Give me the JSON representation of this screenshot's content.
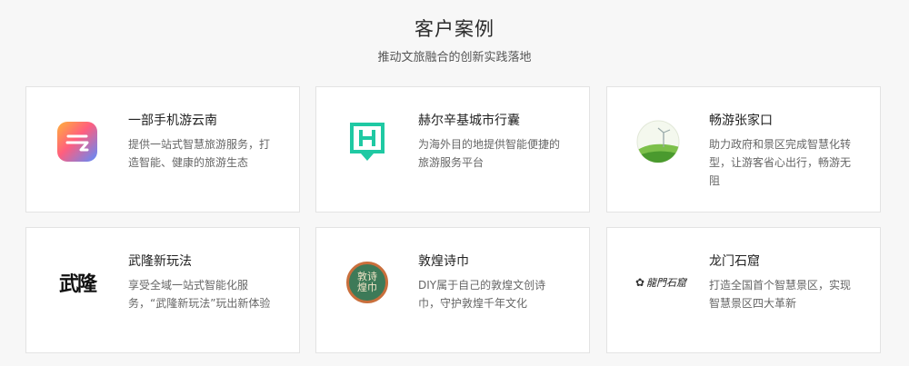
{
  "section": {
    "title": "客户案例",
    "subtitle": "推动文旅融合的创新实践落地"
  },
  "cards": [
    {
      "name": "一部手机游云南",
      "desc": "提供一站式智慧旅游服务，打造智能、健康的旅游生态",
      "logo_icon": "yunnan-app-icon"
    },
    {
      "name": "赫尔辛基城市行囊",
      "desc": "为海外目的地提供智能便捷的旅游服务平台",
      "logo_icon": "helsinki-h-icon"
    },
    {
      "name": "畅游张家口",
      "desc": "助力政府和景区完成智慧化转型，让游客省心出行，畅游无阻",
      "logo_icon": "zhangjiakou-windmill-icon"
    },
    {
      "name": "武隆新玩法",
      "desc": "享受全域一站式智能化服务，“武隆新玩法”玩出新体验",
      "logo_icon": "wulong-calligraphy-icon",
      "logo_text": "武隆"
    },
    {
      "name": "敦煌诗巾",
      "desc": "DIY属于自己的敦煌文创诗巾，守护敦煌千年文化",
      "logo_icon": "dunhuang-seal-icon",
      "logo_text": "敦诗煌巾"
    },
    {
      "name": "龙门石窟",
      "desc": "打造全国首个智慧景区，实现智慧景区四大革新",
      "logo_icon": "longmen-calligraphy-icon",
      "logo_text": "龍門石窟"
    }
  ]
}
